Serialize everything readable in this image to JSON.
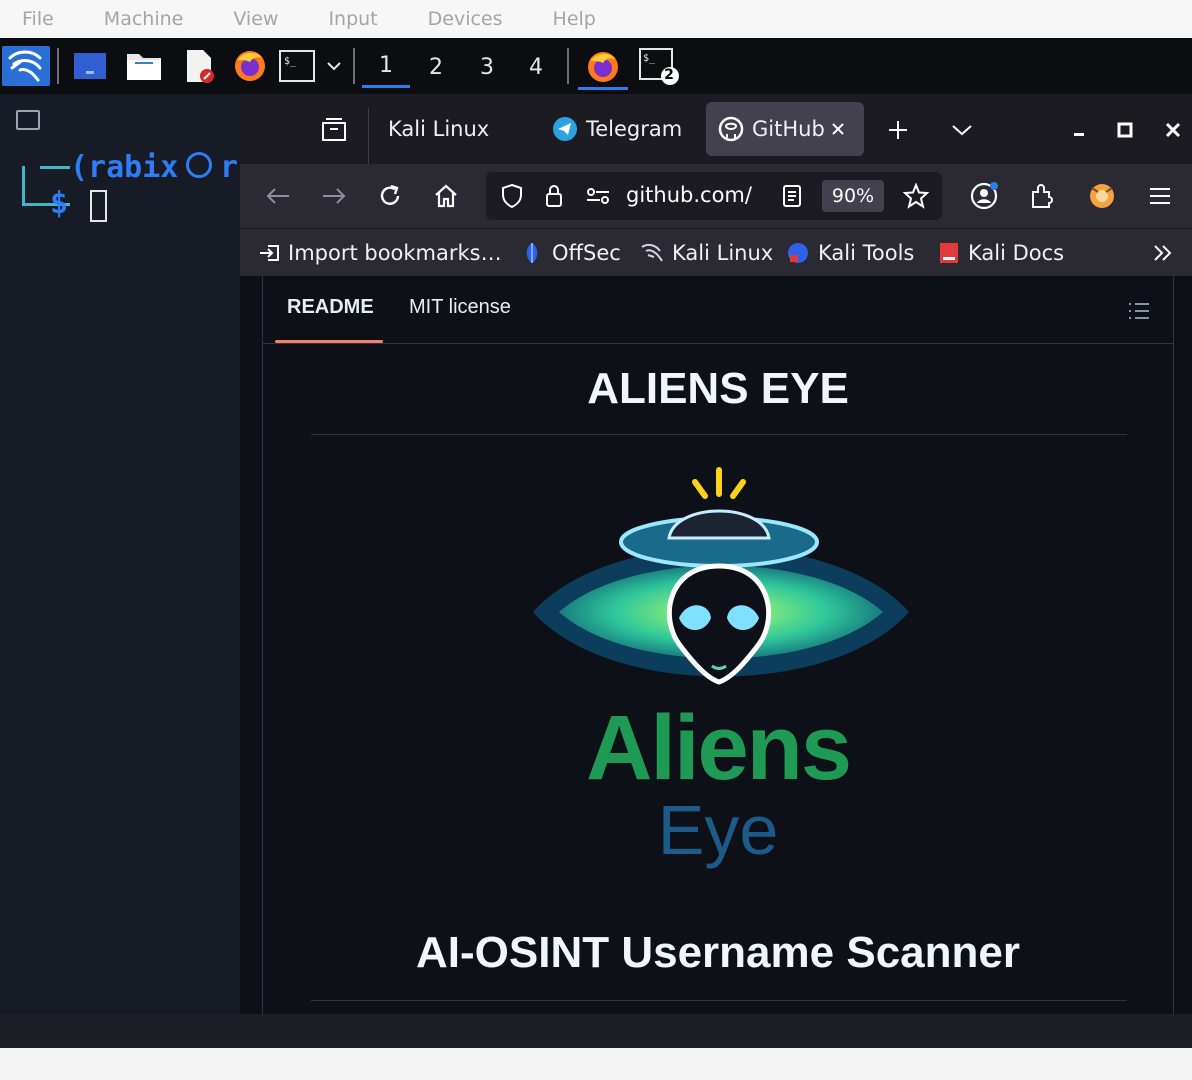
{
  "vbox_menu": [
    "File",
    "Machine",
    "View",
    "Input",
    "Devices",
    "Help"
  ],
  "panel": {
    "workspaces": [
      "1",
      "2",
      "3",
      "4"
    ],
    "active_workspace": "1",
    "terminal_badge": "2"
  },
  "terminal": {
    "prompt_user": "(rabix",
    "prompt_tail": "r",
    "prompt_symbol": "$"
  },
  "browser": {
    "tabs": [
      {
        "label": "Kali Linux"
      },
      {
        "label": "Telegram"
      },
      {
        "label": "GitHub"
      }
    ],
    "url": "github.com/",
    "zoom": "90%",
    "bookmarks": [
      {
        "label": "Import bookmarks…"
      },
      {
        "label": "OffSec"
      },
      {
        "label": "Kali Linux"
      },
      {
        "label": "Kali Tools"
      },
      {
        "label": "Kali Docs"
      }
    ]
  },
  "readme": {
    "tabs": [
      "README",
      "MIT license"
    ],
    "active_tab": "README",
    "heading": "ALIENS EYE",
    "logo_text_top": "Aliens",
    "logo_text_bottom": "Eye",
    "subheading": "AI-OSINT Username Scanner"
  },
  "colors": {
    "accent_tab_underline": "#f78166",
    "workspace_active": "#2b7de9",
    "prompt_blue": "#2f7cf6",
    "prompt_cyan": "#3fb6c4"
  }
}
